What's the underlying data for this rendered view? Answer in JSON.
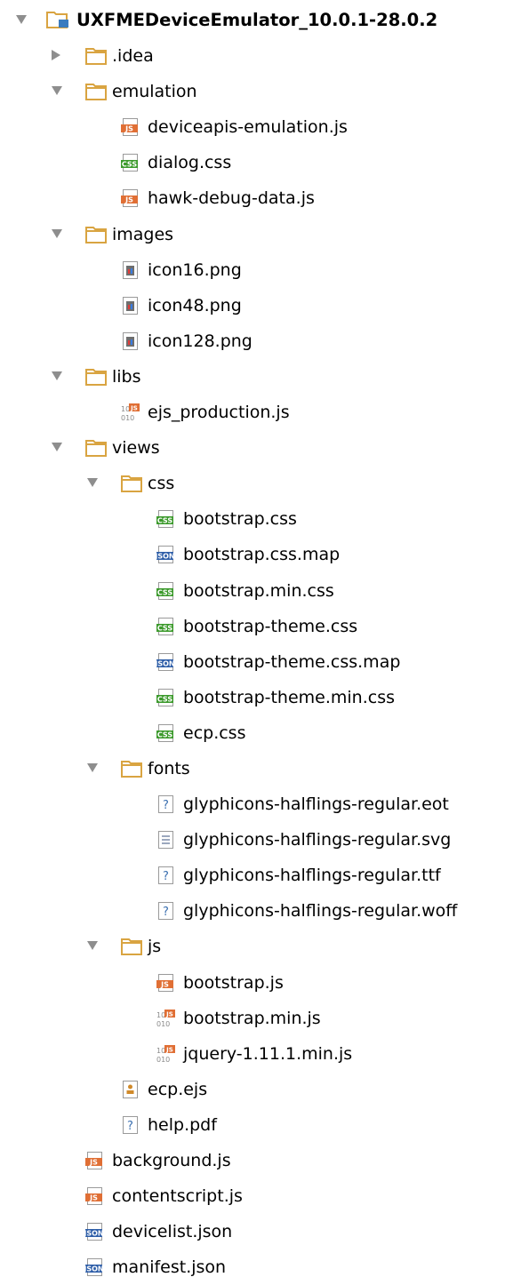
{
  "project_tree": {
    "rows": [
      {
        "depth": 0,
        "kind": "root",
        "expanded": true,
        "label": "UXFMEDeviceEmulator_10.0.1-28.0.2"
      },
      {
        "depth": 1,
        "kind": "folder",
        "expanded": false,
        "label": ".idea"
      },
      {
        "depth": 1,
        "kind": "folder",
        "expanded": true,
        "label": "emulation"
      },
      {
        "depth": 2,
        "kind": "js",
        "label": "deviceapis-emulation.js"
      },
      {
        "depth": 2,
        "kind": "css",
        "label": "dialog.css"
      },
      {
        "depth": 2,
        "kind": "js",
        "label": "hawk-debug-data.js"
      },
      {
        "depth": 1,
        "kind": "folder",
        "expanded": true,
        "label": "images"
      },
      {
        "depth": 2,
        "kind": "image",
        "label": "icon16.png"
      },
      {
        "depth": 2,
        "kind": "image",
        "label": "icon48.png"
      },
      {
        "depth": 2,
        "kind": "image",
        "label": "icon128.png"
      },
      {
        "depth": 1,
        "kind": "folder",
        "expanded": true,
        "label": "libs"
      },
      {
        "depth": 2,
        "kind": "minjs",
        "label": "ejs_production.js"
      },
      {
        "depth": 1,
        "kind": "folder",
        "expanded": true,
        "label": "views"
      },
      {
        "depth": 2,
        "kind": "folder",
        "expanded": true,
        "label": "css"
      },
      {
        "depth": 3,
        "kind": "css",
        "label": "bootstrap.css"
      },
      {
        "depth": 3,
        "kind": "json",
        "label": "bootstrap.css.map"
      },
      {
        "depth": 3,
        "kind": "css",
        "label": "bootstrap.min.css"
      },
      {
        "depth": 3,
        "kind": "css",
        "label": "bootstrap-theme.css"
      },
      {
        "depth": 3,
        "kind": "json",
        "label": "bootstrap-theme.css.map"
      },
      {
        "depth": 3,
        "kind": "css",
        "label": "bootstrap-theme.min.css"
      },
      {
        "depth": 3,
        "kind": "css",
        "label": "ecp.css"
      },
      {
        "depth": 2,
        "kind": "folder",
        "expanded": true,
        "label": "fonts"
      },
      {
        "depth": 3,
        "kind": "unknown",
        "label": "glyphicons-halflings-regular.eot"
      },
      {
        "depth": 3,
        "kind": "text",
        "label": "glyphicons-halflings-regular.svg"
      },
      {
        "depth": 3,
        "kind": "unknown",
        "label": "glyphicons-halflings-regular.ttf"
      },
      {
        "depth": 3,
        "kind": "unknown",
        "label": "glyphicons-halflings-regular.woff"
      },
      {
        "depth": 2,
        "kind": "folder",
        "expanded": true,
        "label": "js"
      },
      {
        "depth": 3,
        "kind": "js",
        "label": "bootstrap.js"
      },
      {
        "depth": 3,
        "kind": "minjs",
        "label": "bootstrap.min.js"
      },
      {
        "depth": 3,
        "kind": "minjs",
        "label": "jquery-1.11.1.min.js"
      },
      {
        "depth": 2,
        "kind": "ejs",
        "label": "ecp.ejs"
      },
      {
        "depth": 2,
        "kind": "unknown",
        "label": "help.pdf"
      },
      {
        "depth": 1,
        "kind": "js",
        "label": "background.js"
      },
      {
        "depth": 1,
        "kind": "js",
        "label": "contentscript.js"
      },
      {
        "depth": 1,
        "kind": "json",
        "label": "devicelist.json"
      },
      {
        "depth": 1,
        "kind": "json",
        "label": "manifest.json"
      }
    ]
  },
  "icon_names": {
    "root": "project-folder-icon",
    "folder": "folder-icon",
    "js": "js-file-icon",
    "css": "css-file-icon",
    "json": "json-file-icon",
    "image": "image-file-icon",
    "minjs": "minified-js-file-icon",
    "unknown": "unknown-file-icon",
    "text": "text-file-icon",
    "ejs": "ejs-template-file-icon"
  },
  "colors": {
    "folder": "#d9a441",
    "js_badge": "#e06f35",
    "css_badge": "#3c9a2c",
    "json_badge": "#2e5ea8",
    "tree_arrow": "#8e8e8e",
    "root_badge": "#3a7bbf"
  }
}
